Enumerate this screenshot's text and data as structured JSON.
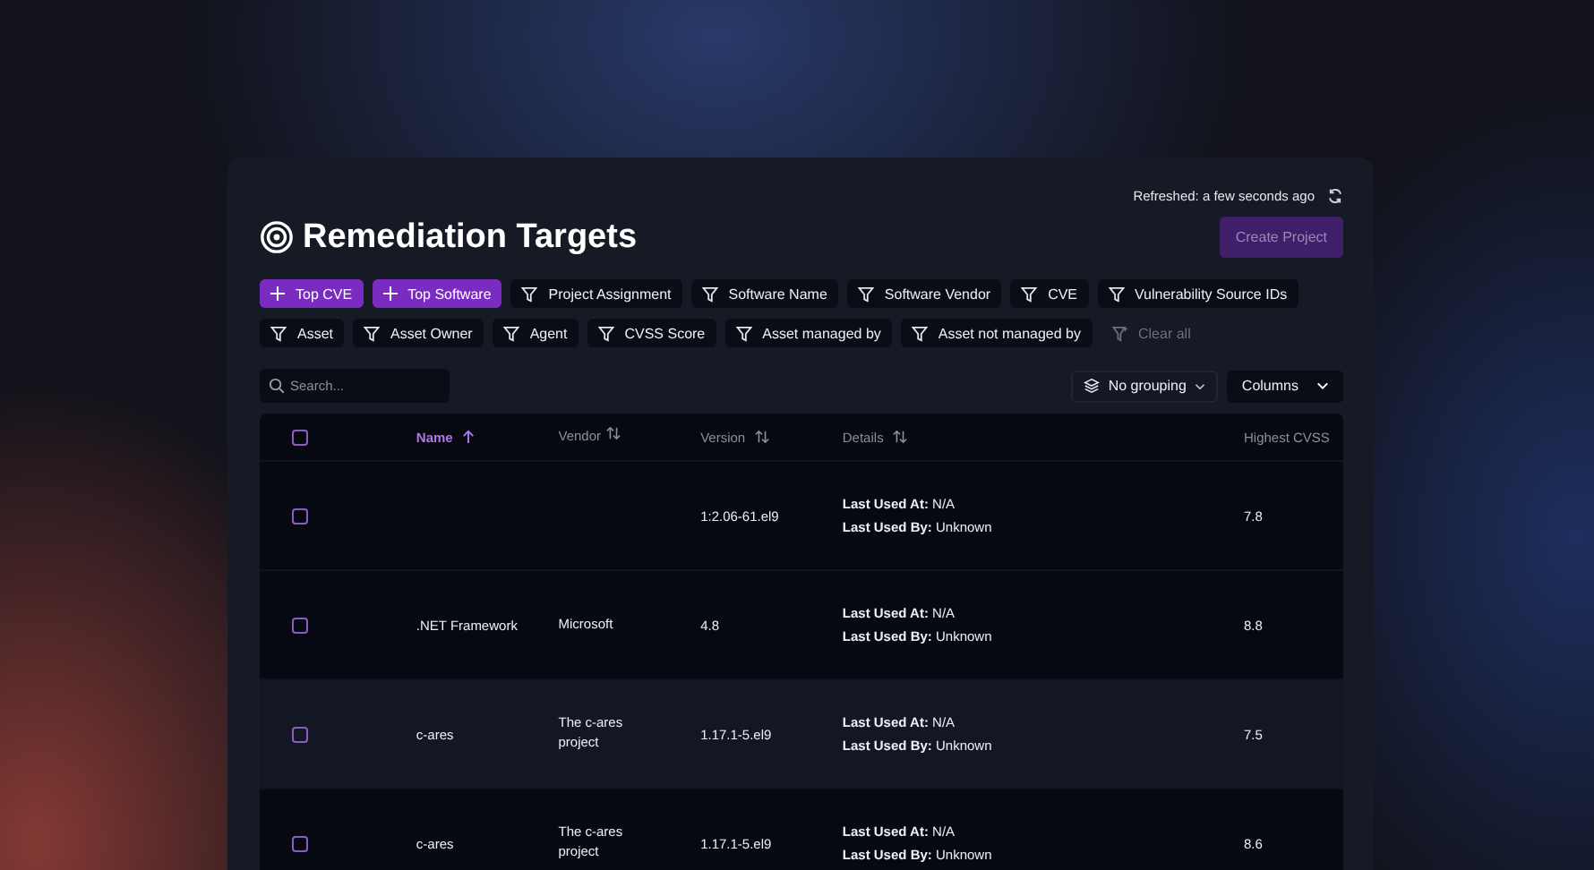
{
  "refresh": {
    "text": "Refreshed: a few seconds ago"
  },
  "title": "Remediation Targets",
  "create_button": {
    "label": "Create Project",
    "disabled": true
  },
  "filters": [
    {
      "label": "Top CVE",
      "kind": "add"
    },
    {
      "label": "Top Software",
      "kind": "add"
    },
    {
      "label": "Project Assignment",
      "kind": "filter"
    },
    {
      "label": "Software Name",
      "kind": "filter"
    },
    {
      "label": "Software Vendor",
      "kind": "filter"
    },
    {
      "label": "CVE",
      "kind": "filter"
    },
    {
      "label": "Vulnerability Source IDs",
      "kind": "filter"
    },
    {
      "label": "Asset",
      "kind": "filter"
    },
    {
      "label": "Asset Owner",
      "kind": "filter"
    },
    {
      "label": "Agent",
      "kind": "filter"
    },
    {
      "label": "CVSS Score",
      "kind": "filter"
    },
    {
      "label": "Asset managed by",
      "kind": "filter"
    },
    {
      "label": "Asset not managed by",
      "kind": "filter"
    },
    {
      "label": "Clear all",
      "kind": "clear"
    }
  ],
  "search": {
    "placeholder": "Search..."
  },
  "grouping": {
    "label": "No grouping"
  },
  "columns_button": {
    "label": "Columns"
  },
  "table": {
    "select_all_checked": false,
    "columns": [
      {
        "label": "Name",
        "sortable": true,
        "sorted": true
      },
      {
        "label": "Vendor",
        "sortable": true,
        "sorted": false
      },
      {
        "label": "Version",
        "sortable": true,
        "sorted": false
      },
      {
        "label": "Details",
        "sortable": true,
        "sorted": false
      },
      {
        "label": "Highest CVSS",
        "sortable": false,
        "sorted": false
      }
    ],
    "rows": [
      {
        "checked": false,
        "highlighted": false,
        "name": "",
        "vendor": "",
        "version": "1:2.06-61.el9",
        "details": [
          "**Last Used At:** N/A",
          "**Last Used By:** Unknown"
        ],
        "cvss": "7.8"
      },
      {
        "checked": false,
        "highlighted": false,
        "name": ".NET Framework",
        "vendor": "Microsoft",
        "version": "4.8",
        "details": [
          "**Last Used At:** N/A",
          "**Last Used By:** Unknown"
        ],
        "cvss": "8.8"
      },
      {
        "checked": false,
        "highlighted": true,
        "name": "c-ares",
        "vendor": "The c-ares project",
        "version": "1.17.1-5.el9",
        "details": [
          "**Last Used At:** N/A",
          "**Last Used By:** Unknown"
        ],
        "cvss": "7.5"
      },
      {
        "checked": false,
        "highlighted": false,
        "name": "c-ares",
        "vendor": "The c-ares project",
        "version": "1.17.1-5.el9",
        "details": [
          "**Last Used At:** N/A",
          "**Last Used By:** Unknown"
        ],
        "cvss": "8.6"
      }
    ]
  }
}
